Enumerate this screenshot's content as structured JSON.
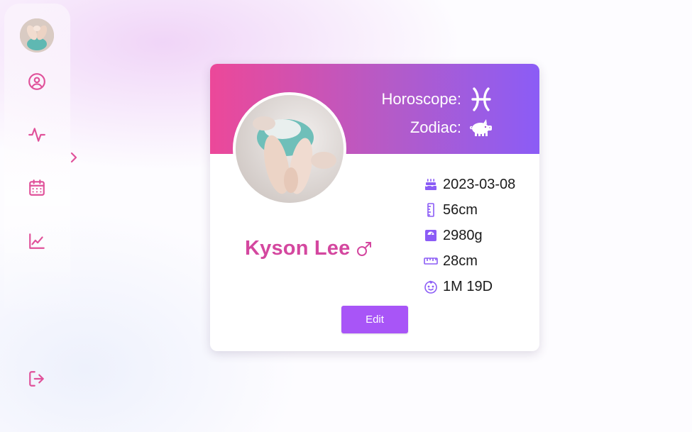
{
  "colors": {
    "accent_pink": "#d4479f",
    "icon_pink": "#e0519a",
    "icon_purple": "#8b5cf6",
    "button_purple": "#a855f7",
    "banner_start": "#ec4899",
    "banner_end": "#8b5cf6"
  },
  "sidebar": {
    "items": [
      {
        "name": "profile",
        "icon": "user-circle-icon"
      },
      {
        "name": "activity",
        "icon": "activity-icon"
      },
      {
        "name": "calendar",
        "icon": "calendar-icon"
      },
      {
        "name": "growth-chart",
        "icon": "chart-line-icon"
      }
    ],
    "toggle_icon": "chevron-right-icon",
    "logout_icon": "logout-icon"
  },
  "profile": {
    "horoscope_label": "Horoscope:",
    "horoscope_icon": "pisces-icon",
    "zodiac_label": "Zodiac:",
    "zodiac_icon": "pig-icon",
    "name": "Kyson Lee",
    "gender_symbol": "♂",
    "stats": {
      "birthday": "2023-03-08",
      "height": "56cm",
      "weight": "2980g",
      "head_circumference": "28cm",
      "age": "1M 19D"
    },
    "edit_label": "Edit"
  }
}
